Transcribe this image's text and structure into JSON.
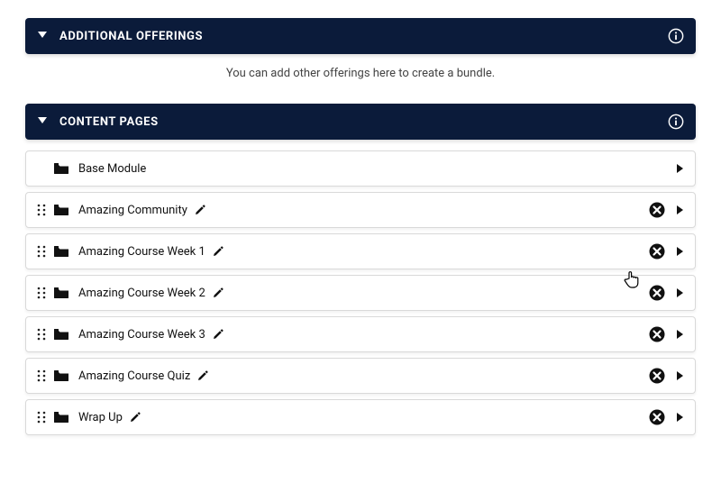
{
  "sections": {
    "additional_offerings": {
      "title": "ADDITIONAL OFFERINGS",
      "subtext": "You can add other offerings here to create a bundle."
    },
    "content_pages": {
      "title": "CONTENT PAGES",
      "items": [
        {
          "label": "Base Module",
          "draggable": false,
          "editable": false,
          "deletable": false
        },
        {
          "label": "Amazing Community",
          "draggable": true,
          "editable": true,
          "deletable": true
        },
        {
          "label": "Amazing Course Week 1",
          "draggable": true,
          "editable": true,
          "deletable": true
        },
        {
          "label": "Amazing Course Week 2",
          "draggable": true,
          "editable": true,
          "deletable": true
        },
        {
          "label": "Amazing Course Week 3",
          "draggable": true,
          "editable": true,
          "deletable": true
        },
        {
          "label": "Amazing Course Quiz",
          "draggable": true,
          "editable": true,
          "deletable": true
        },
        {
          "label": "Wrap Up",
          "draggable": true,
          "editable": true,
          "deletable": true
        }
      ]
    }
  },
  "colors": {
    "header_bg": "#0b1b3a"
  }
}
